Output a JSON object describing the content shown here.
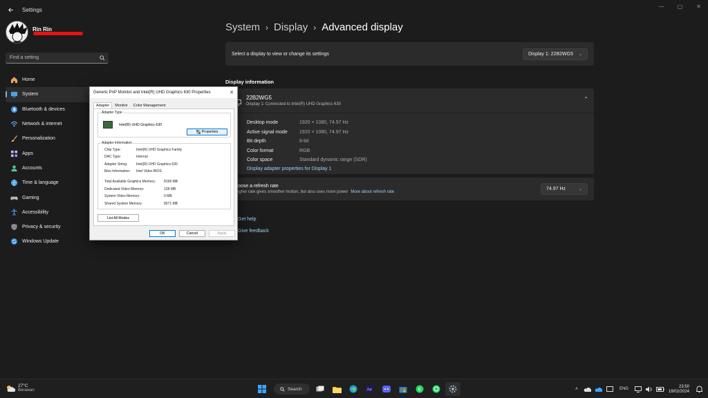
{
  "window": {
    "title": "Settings"
  },
  "sidebar": {
    "user_name": "Rin Rin",
    "search_placeholder": "Find a setting",
    "items": [
      {
        "label": "Home",
        "icon": "home-icon"
      },
      {
        "label": "System",
        "icon": "system-icon",
        "active": true
      },
      {
        "label": "Bluetooth & devices",
        "icon": "bluetooth-icon"
      },
      {
        "label": "Network & internet",
        "icon": "wifi-icon"
      },
      {
        "label": "Personalization",
        "icon": "brush-icon"
      },
      {
        "label": "Apps",
        "icon": "apps-icon"
      },
      {
        "label": "Accounts",
        "icon": "accounts-icon"
      },
      {
        "label": "Time & language",
        "icon": "globe-icon"
      },
      {
        "label": "Gaming",
        "icon": "gamepad-icon"
      },
      {
        "label": "Accessibility",
        "icon": "accessibility-icon"
      },
      {
        "label": "Privacy & security",
        "icon": "shield-icon"
      },
      {
        "label": "Windows Update",
        "icon": "update-icon"
      }
    ]
  },
  "main": {
    "breadcrumb": {
      "a": "System",
      "b": "Display",
      "c": "Advanced display"
    },
    "select_display": {
      "text": "Select a display to view or change its settings",
      "value": "Display 1: 22B2WG5"
    },
    "section_title": "Display information",
    "info": {
      "name": "22B2WG5",
      "sub": "Display 1: Connected to Intel(R) UHD Graphics 630",
      "rows": [
        {
          "label": "Desktop mode",
          "value": "1920 × 1080, 74.97 Hz"
        },
        {
          "label": "Active signal mode",
          "value": "1920 × 1080, 74.97 Hz"
        },
        {
          "label": "Bit depth",
          "value": "8-bit"
        },
        {
          "label": "Color format",
          "value": "RGB"
        },
        {
          "label": "Color space",
          "value": "Standard dynamic range (SDR)"
        }
      ],
      "link": "Display adapter properties for Display 1"
    },
    "refresh": {
      "title": "oose a refresh rate",
      "desc": "igher rate gives smoother motion, but also uses more power",
      "link": "More about refresh rate",
      "value": "74.97 Hz"
    },
    "help": {
      "get_help": "Get help",
      "feedback": "Give feedback"
    }
  },
  "dialog": {
    "title": "Generic PnP Monitor and Intel(R) UHD Graphics 630 Properties",
    "tabs": [
      "Adapter",
      "Monitor",
      "Color Management"
    ],
    "adapter_type_label": "Adapter Type",
    "adapter_name": "Intel(R) UHD Graphics 630",
    "properties_button": "Properties",
    "adapter_info_label": "Adapter Information",
    "info_rows": [
      {
        "k": "Chip Type:",
        "v": "Intel(R) UHD Graphics Family"
      },
      {
        "k": "DAC Type:",
        "v": "Internal"
      },
      {
        "k": "Adapter String:",
        "v": "Intel(R) UHD Graphics 630"
      },
      {
        "k": "Bios Information:",
        "v": "Intel Video BIOS"
      }
    ],
    "memory_rows": [
      {
        "k": "Total Available Graphics Memory:",
        "v": "8199 MB"
      },
      {
        "k": "Dedicated Video Memory:",
        "v": "128 MB"
      },
      {
        "k": "System Video Memory:",
        "v": "0 MB"
      },
      {
        "k": "Shared System Memory:",
        "v": "8071 MB"
      }
    ],
    "list_all_modes": "List All Modes",
    "ok": "OK",
    "cancel": "Cancel",
    "apply": "Apply"
  },
  "taskbar": {
    "weather_temp": "27°C",
    "weather_desc": "Berawan",
    "search_label": "Search",
    "lang": "ENG",
    "time": "23:50",
    "date": "19/02/2024"
  }
}
